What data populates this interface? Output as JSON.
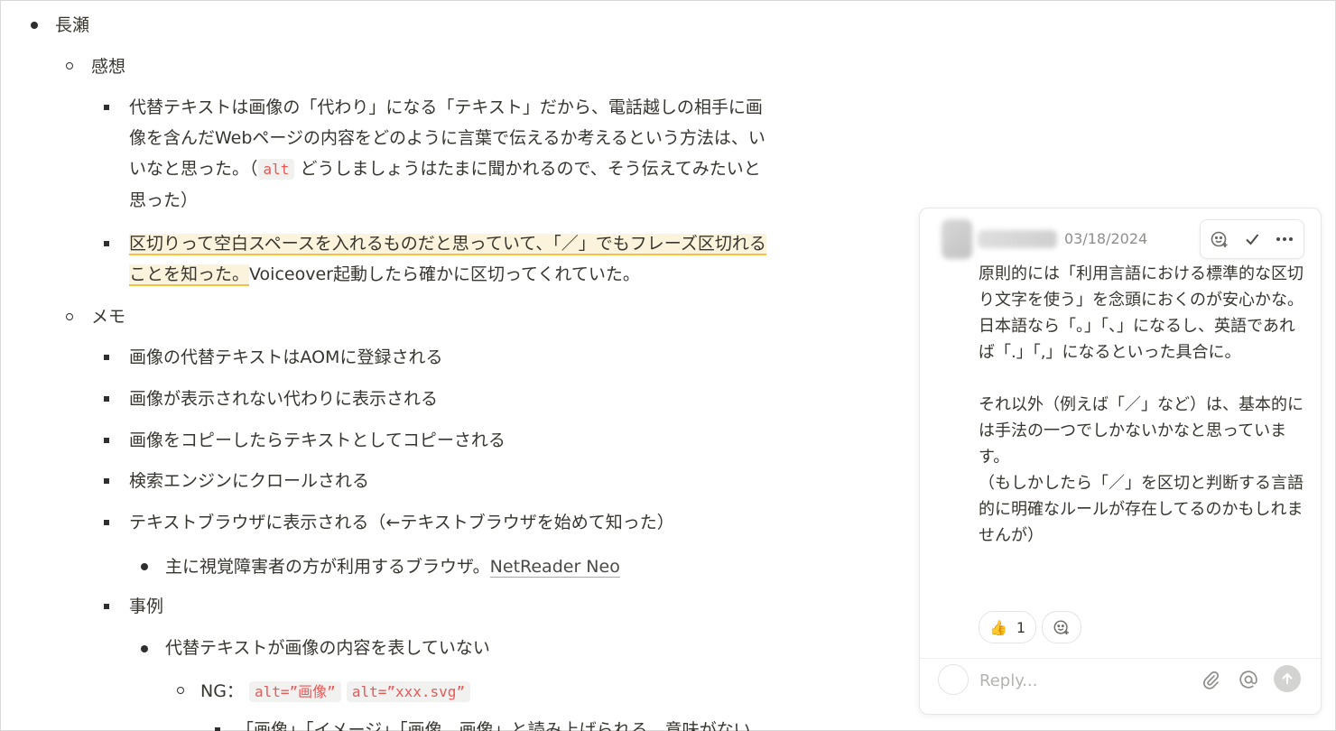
{
  "doc": {
    "l1_nagase": "長瀬",
    "l2_kansou": "感想",
    "p1": {
      "line1": "代替テキストは画像の「代わり」になる「テキスト」だから、電話越しの相手に画",
      "line2": "像を含んだWebページの内容をどのように言葉で伝えるか考えるという方法は、い",
      "line3_pre": "いなと思った。（",
      "line3_code": "alt",
      "line3_post": "どうしましょうはたまに聞かれるので、そう伝えてみたいと",
      "line4": "思った）"
    },
    "p2": {
      "hl1": "区切りって空白スペースを入れるものだと思っていて、「／」でもフレーズ区切れる",
      "hl2": "ことを知った。",
      "rest": "Voiceover起動したら確かに区切ってくれていた。"
    },
    "l2_memo": "メモ",
    "memo_items": [
      "画像の代替テキストはAOMに登録される",
      "画像が表示されない代わりに表示される",
      "画像をコピーしたらテキストとしてコピーされる",
      "検索エンジンにクロールされる",
      "テキストブラウザに表示される（←テキストブラウザを始めて知った）"
    ],
    "browser_note": "主に視覚障害者の方が利用するブラウザ。",
    "browser_link": "NetReader Neo",
    "jirei": "事例",
    "jirei_item": "代替テキストが画像の内容を表していない",
    "ng_label": "NG：",
    "ng_code1": "alt=”画像”",
    "ng_code2": "alt=”xxx.svg”",
    "cut_line": "「画像」「イメージ」「画像、画像」と読み上げられる、意味がない"
  },
  "comment": {
    "date": "03/18/2024",
    "body": "原則的には「利用言語における標準的な区切り文字を使う」を念頭におくのが安心かな。\n日本語なら「。」「、」になるし、英語であれば「.」「,」になるといった具合に。\n\nそれ以外（例えば「／」など）は、基本的には手法の一つでしかないかなと思っています。\n（もしかしたら「／」を区切と判断する言語的に明確なルールが存在してるのかもしれませんが）",
    "reaction_emoji": "👍",
    "reaction_count": "1",
    "reply_placeholder": "Reply...",
    "icons": [
      "add-reaction-icon",
      "resolve-check-icon",
      "more-icon",
      "attachment-icon",
      "mention-icon",
      "send-icon"
    ]
  }
}
